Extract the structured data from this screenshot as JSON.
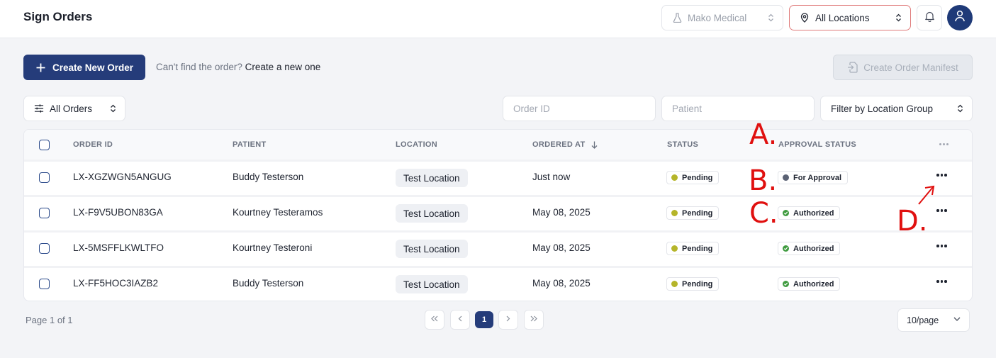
{
  "header": {
    "title": "Sign Orders",
    "org_selector": "Mako Medical",
    "location_selector": "All Locations"
  },
  "toolbar": {
    "create_label": "Create New Order",
    "hint_text": "Can't find the order?",
    "hint_link": "Create a new one",
    "manifest_label": "Create Order Manifest"
  },
  "filters": {
    "orders_filter": "All Orders",
    "order_id_placeholder": "Order ID",
    "patient_placeholder": "Patient",
    "location_group": "Filter by Location Group"
  },
  "table": {
    "headers": {
      "order_id": "ORDER ID",
      "patient": "PATIENT",
      "location": "LOCATION",
      "ordered_at": "ORDERED AT",
      "status": "STATUS",
      "approval": "APPROVAL STATUS"
    },
    "rows": [
      {
        "order_id": "LX-XGZWGN5ANGUG",
        "patient": "Buddy Testerson",
        "location": "Test Location",
        "ordered_at": "Just now",
        "status": "Pending",
        "approval": "For Approval"
      },
      {
        "order_id": "LX-F9V5UBON83GA",
        "patient": "Kourtney Testeramos",
        "location": "Test Location",
        "ordered_at": "May 08, 2025",
        "status": "Pending",
        "approval": "Authorized"
      },
      {
        "order_id": "LX-5MSFFLKWLTFO",
        "patient": "Kourtney Testeroni",
        "location": "Test Location",
        "ordered_at": "May 08, 2025",
        "status": "Pending",
        "approval": "Authorized"
      },
      {
        "order_id": "LX-FF5HOC3IAZB2",
        "patient": "Buddy Testerson",
        "location": "Test Location",
        "ordered_at": "May 08, 2025",
        "status": "Pending",
        "approval": "Authorized"
      }
    ]
  },
  "pagination": {
    "page_info": "Page 1 of 1",
    "current_page": "1",
    "per_page": "10/page"
  },
  "annotations": {
    "a": "A.",
    "b": "B.",
    "c": "C.",
    "d": "D."
  },
  "colors": {
    "primary": "#253c7a",
    "pending": "#b5b52a",
    "for_approval": "#5b6274",
    "authorized": "#3f9b3f",
    "annotation": "#e0100f"
  }
}
